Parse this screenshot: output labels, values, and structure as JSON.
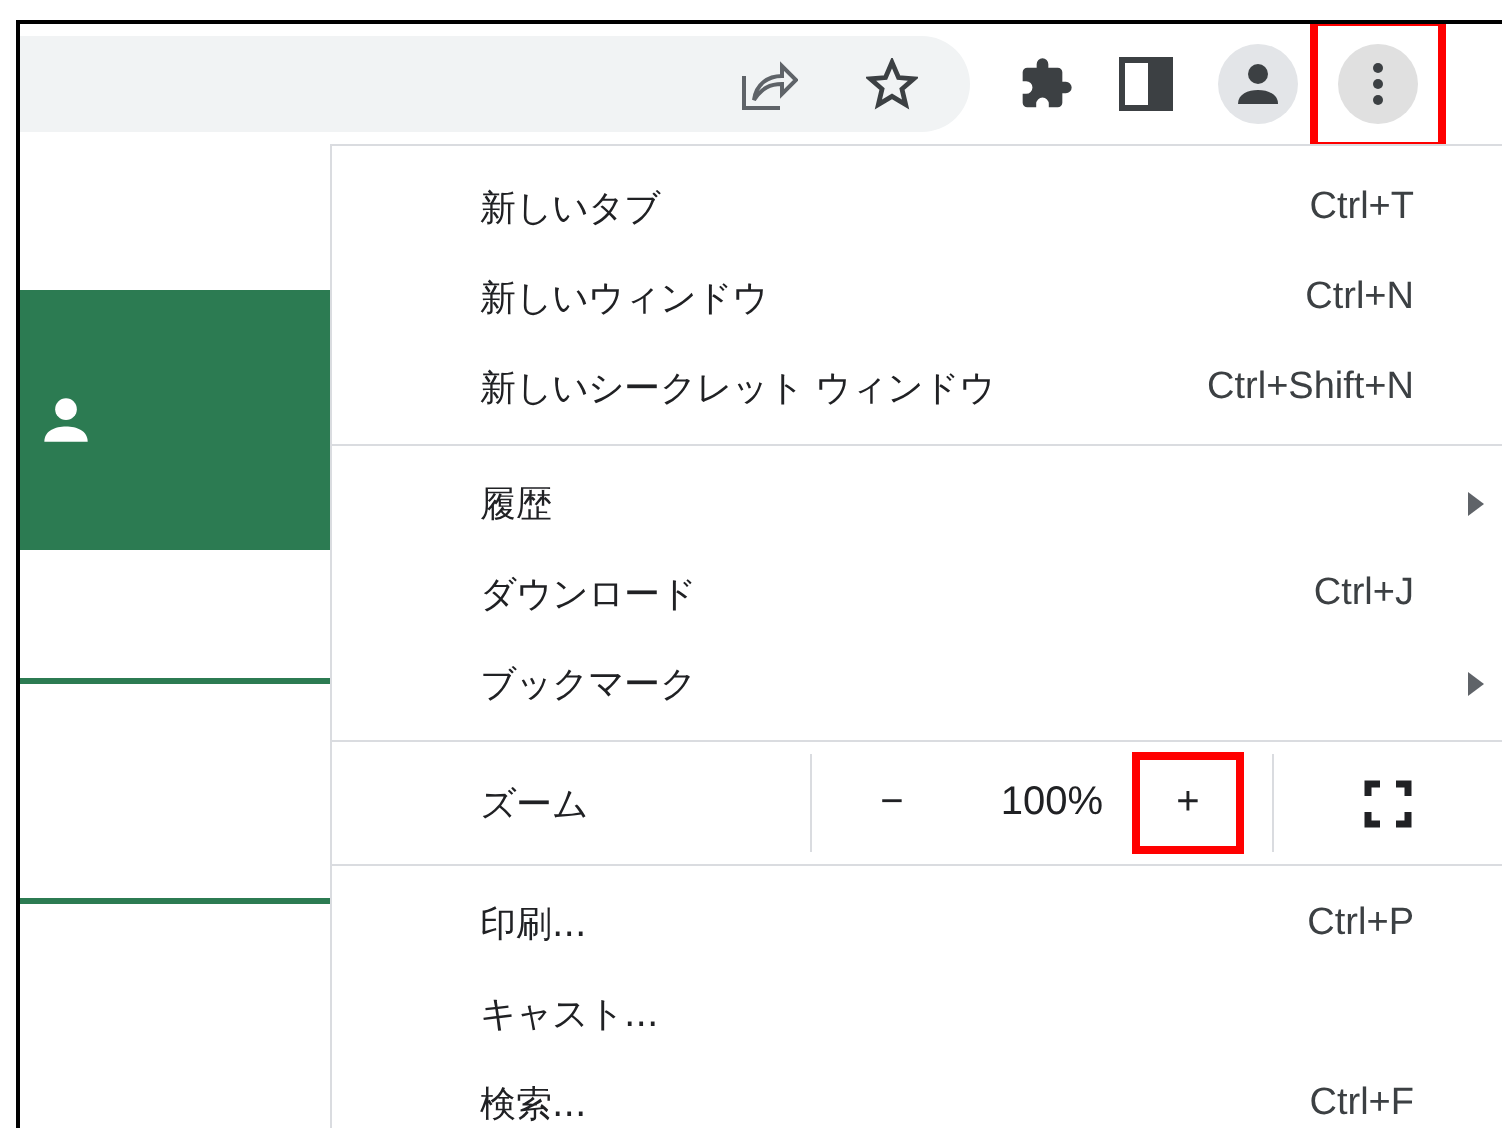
{
  "toolbar": {
    "menu_button": {
      "highlighted": true
    }
  },
  "menu": {
    "sections": [
      {
        "kind": "items",
        "items": [
          {
            "label": "新しいタブ",
            "shortcut": "Ctrl+T",
            "submenu": false
          },
          {
            "label": "新しいウィンドウ",
            "shortcut": "Ctrl+N",
            "submenu": false
          },
          {
            "label": "新しいシークレット ウィンドウ",
            "shortcut": "Ctrl+Shift+N",
            "submenu": false
          }
        ]
      },
      {
        "kind": "items",
        "items": [
          {
            "label": "履歴",
            "submenu": true
          },
          {
            "label": "ダウンロード",
            "shortcut": "Ctrl+J",
            "submenu": false
          },
          {
            "label": "ブックマーク",
            "submenu": true
          }
        ]
      },
      {
        "kind": "zoom",
        "label": "ズーム",
        "minus": "−",
        "level_text": "100%",
        "plus": "+",
        "plus_highlighted": true
      },
      {
        "kind": "items",
        "items": [
          {
            "label": "印刷...",
            "shortcut": "Ctrl+P",
            "submenu": false
          },
          {
            "label": "キャスト...",
            "submenu": false
          },
          {
            "label": "検索...",
            "shortcut": "Ctrl+F",
            "submenu": false
          }
        ]
      }
    ]
  }
}
